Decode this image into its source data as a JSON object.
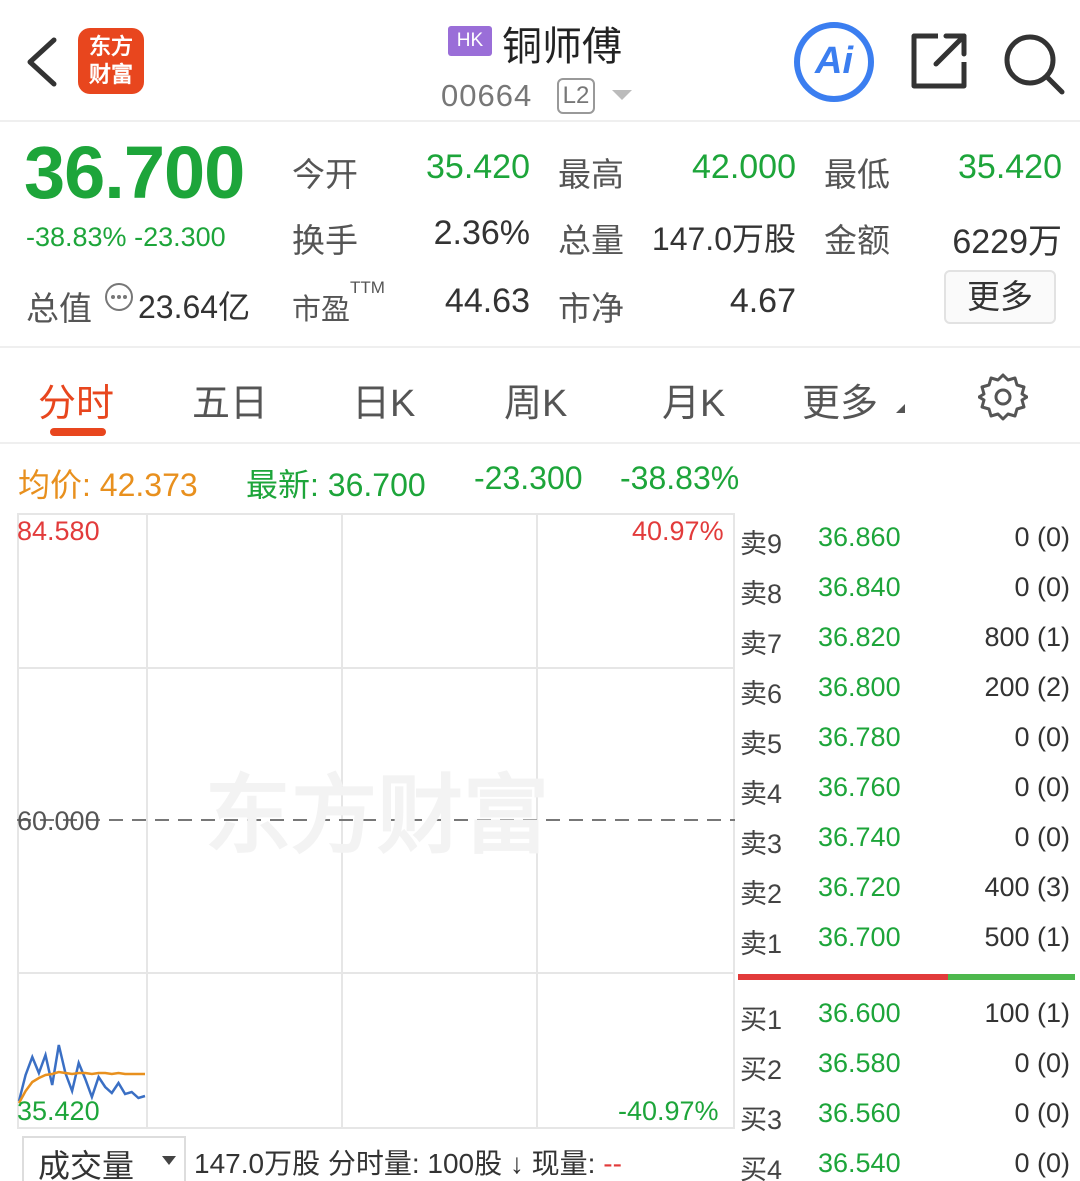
{
  "header": {
    "logo_text_line1": "东方",
    "logo_text_line2": "财富",
    "market_badge": "HK",
    "stock_name": "铜师傅",
    "stock_code": "00664",
    "level_badge": "L2",
    "ai_label": "Ai"
  },
  "quote": {
    "price": "36.700",
    "change_pct": "-38.83%",
    "change_amt": "-23.300",
    "open_label": "今开",
    "open_value": "35.420",
    "high_label": "最高",
    "high_value": "42.000",
    "low_label": "最低",
    "low_value": "35.420",
    "turnover_label": "换手",
    "turnover_value": "2.36%",
    "volume_label": "总量",
    "volume_value": "147.0万股",
    "amount_label": "金额",
    "amount_value": "6229万",
    "mktcap_label": "总值",
    "mktcap_value": "23.64亿",
    "pe_label": "市盈",
    "pe_sup": "TTM",
    "pe_value": "44.63",
    "pb_label": "市净",
    "pb_value": "4.67",
    "more_label": "更多"
  },
  "tabs": [
    "分时",
    "五日",
    "日K",
    "周K",
    "月K",
    "更多"
  ],
  "info_line": {
    "avg_label": "均价:",
    "avg_value": "42.373",
    "latest_label": "最新:",
    "latest_value": "36.700",
    "change_amt": "-23.300",
    "change_pct": "-38.83%"
  },
  "chart": {
    "top_price": "84.580",
    "top_pct": "40.97%",
    "mid_price": "60.000",
    "bottom_price": "35.420",
    "bottom_pct": "-40.97%",
    "watermark": "东方财富",
    "colors": {
      "price_line": "#3a6fc4",
      "avg_line": "#e8901e",
      "up": "#e23b3b",
      "down": "#1da53a"
    }
  },
  "chart_data": {
    "type": "line",
    "title": "",
    "xlabel": "",
    "ylabel": "",
    "ylim": [
      35.42,
      84.58
    ],
    "grid": true,
    "series": [
      {
        "values": [
          36.2,
          38.8,
          40.6,
          39.0,
          40.8,
          37.8,
          41.8,
          39.0,
          37.2,
          40.0,
          38.4,
          36.6,
          38.6,
          37.6,
          37.0,
          38.0,
          36.9,
          37.1,
          36.5,
          36.7
        ]
      },
      {
        "values": [
          36.0,
          37.2,
          38.1,
          38.5,
          38.8,
          38.9,
          39.1,
          39.0,
          38.9,
          39.0,
          39.0,
          38.9,
          39.0,
          39.0,
          38.9,
          39.0,
          38.9,
          38.9,
          38.9,
          38.9
        ]
      }
    ]
  },
  "order_book": {
    "asks": [
      {
        "side": "卖9",
        "price": "36.860",
        "vol": "0 (0)"
      },
      {
        "side": "卖8",
        "price": "36.840",
        "vol": "0 (0)"
      },
      {
        "side": "卖7",
        "price": "36.820",
        "vol": "800 (1)"
      },
      {
        "side": "卖6",
        "price": "36.800",
        "vol": "200 (2)"
      },
      {
        "side": "卖5",
        "price": "36.780",
        "vol": "0 (0)"
      },
      {
        "side": "卖4",
        "price": "36.760",
        "vol": "0 (0)"
      },
      {
        "side": "卖3",
        "price": "36.740",
        "vol": "0 (0)"
      },
      {
        "side": "卖2",
        "price": "36.720",
        "vol": "400 (3)"
      },
      {
        "side": "卖1",
        "price": "36.700",
        "vol": "500 (1)"
      }
    ],
    "bids": [
      {
        "side": "买1",
        "price": "36.600",
        "vol": "100 (1)"
      },
      {
        "side": "买2",
        "price": "36.580",
        "vol": "0 (0)"
      },
      {
        "side": "买3",
        "price": "36.560",
        "vol": "0 (0)"
      },
      {
        "side": "买4",
        "price": "36.540",
        "vol": "0 (0)"
      }
    ]
  },
  "bottom": {
    "volume_select": "成交量",
    "volume_info": "147.0万股 分时量: 100股 ↓ 现量: ",
    "current_volume": "--"
  }
}
